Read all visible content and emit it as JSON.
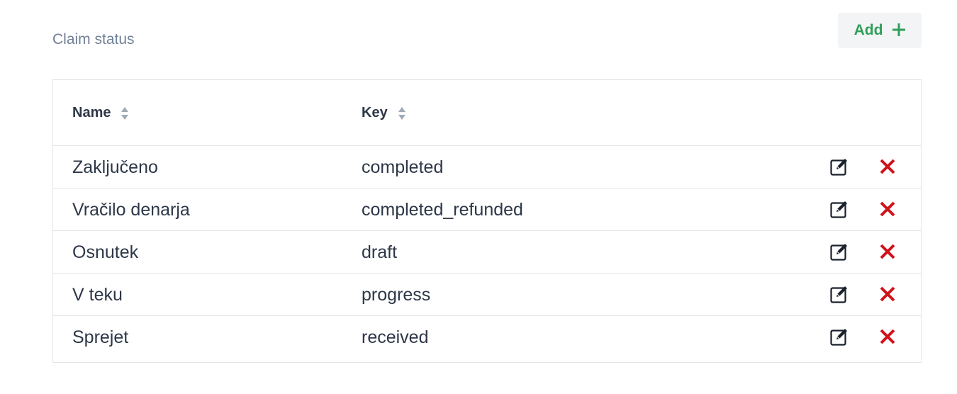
{
  "section": {
    "title": "Claim status"
  },
  "toolbar": {
    "add_label": "Add",
    "add_icon": "plus-icon",
    "accent_color": "#2f9e58"
  },
  "table": {
    "headers": {
      "name": "Name",
      "key": "Key"
    },
    "sort_icon": "sort-icon",
    "row_actions": {
      "edit_icon": "edit-icon",
      "delete_icon": "close-icon",
      "delete_color": "#d0121b"
    },
    "rows": [
      {
        "name": "Zaključeno",
        "key": "completed"
      },
      {
        "name": "Vračilo denarja",
        "key": "completed_refunded"
      },
      {
        "name": "Osnutek",
        "key": "draft"
      },
      {
        "name": "V teku",
        "key": "progress"
      },
      {
        "name": "Sprejet",
        "key": "received"
      }
    ]
  }
}
